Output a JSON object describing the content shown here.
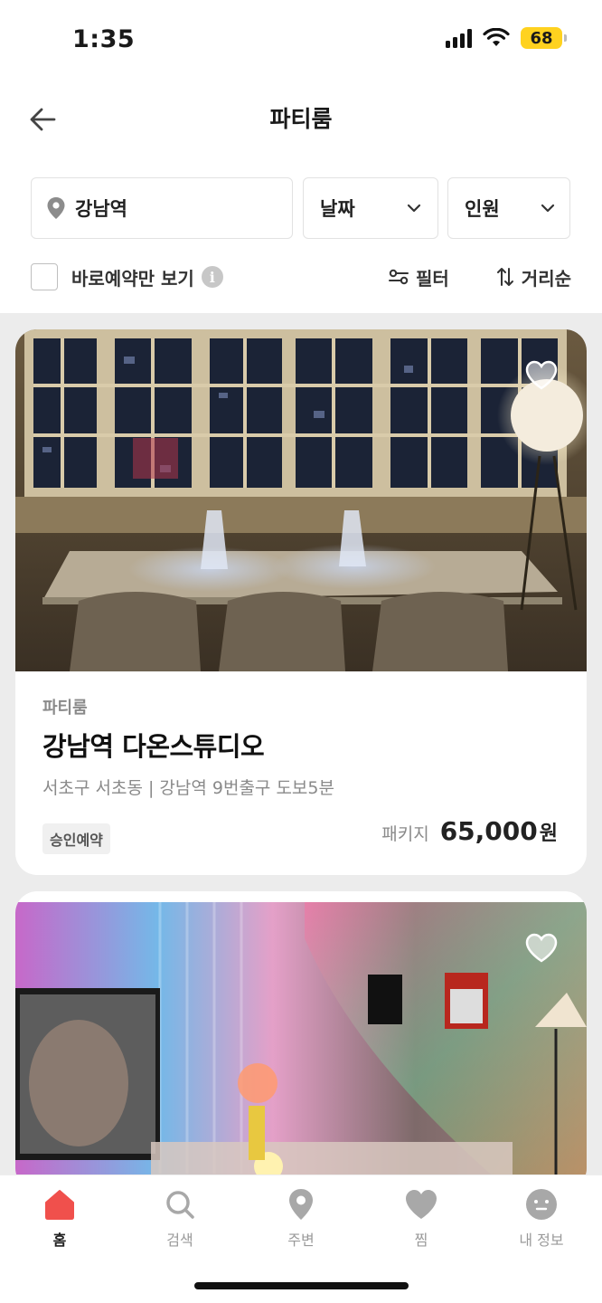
{
  "status_bar": {
    "time": "1:35",
    "battery": "68",
    "battery_color": "#ffd21f"
  },
  "header": {
    "title": "파티룸",
    "back_icon": "arrow-left-icon"
  },
  "filters": {
    "location": "강남역",
    "date": "날짜",
    "people": "인원",
    "instant_label": "바로예약만 보기",
    "instant_checked": false,
    "filter_label": "필터",
    "sort_label": "거리순"
  },
  "listings": [
    {
      "category": "파티룸",
      "title": "강남역 다온스튜디오",
      "subtitle": "서초구 서초동 | 강남역 9번출구 도보5분",
      "badge": "승인예약",
      "price_label": "패키지",
      "price": "65,000",
      "price_unit": "원",
      "favorited": false
    },
    {
      "favorited": false
    }
  ],
  "bottom_nav": {
    "accent": "#f0504c",
    "items": [
      {
        "label": "홈",
        "icon": "home-icon",
        "active": true
      },
      {
        "label": "검색",
        "icon": "search-icon",
        "active": false
      },
      {
        "label": "주변",
        "icon": "location-pin-icon",
        "active": false
      },
      {
        "label": "찜",
        "icon": "heart-icon",
        "active": false
      },
      {
        "label": "내 정보",
        "icon": "profile-face-icon",
        "active": false
      }
    ]
  }
}
